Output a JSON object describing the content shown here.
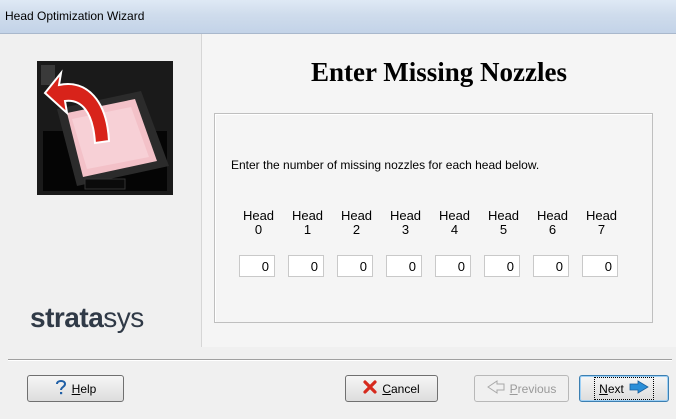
{
  "window": {
    "title": "Head Optimization Wizard"
  },
  "brand": {
    "logo_bold": "strata",
    "logo_light": "sys"
  },
  "page": {
    "heading": "Enter Missing Nozzles",
    "instruction": "Enter the number of missing nozzles for each head below."
  },
  "heads": [
    {
      "label": "Head",
      "number": "0",
      "value": "0"
    },
    {
      "label": "Head",
      "number": "1",
      "value": "0"
    },
    {
      "label": "Head",
      "number": "2",
      "value": "0"
    },
    {
      "label": "Head",
      "number": "3",
      "value": "0"
    },
    {
      "label": "Head",
      "number": "4",
      "value": "0"
    },
    {
      "label": "Head",
      "number": "5",
      "value": "0"
    },
    {
      "label": "Head",
      "number": "6",
      "value": "0"
    },
    {
      "label": "Head",
      "number": "7",
      "value": "0"
    }
  ],
  "buttons": {
    "help": {
      "mnemonic": "H",
      "rest": "elp"
    },
    "cancel": {
      "mnemonic": "C",
      "rest": "ancel"
    },
    "previous": {
      "mnemonic": "P",
      "rest": "revious"
    },
    "next": {
      "mnemonic": "N",
      "rest": "ext"
    }
  },
  "icons": {
    "help": "question-icon",
    "cancel": "red-x-icon",
    "previous": "arrow-left-icon",
    "next": "arrow-right-icon"
  },
  "colors": {
    "cancel_icon": "#d62a1e",
    "next_arrow": "#2b8fd8",
    "help_icon": "#1f5fa6"
  }
}
